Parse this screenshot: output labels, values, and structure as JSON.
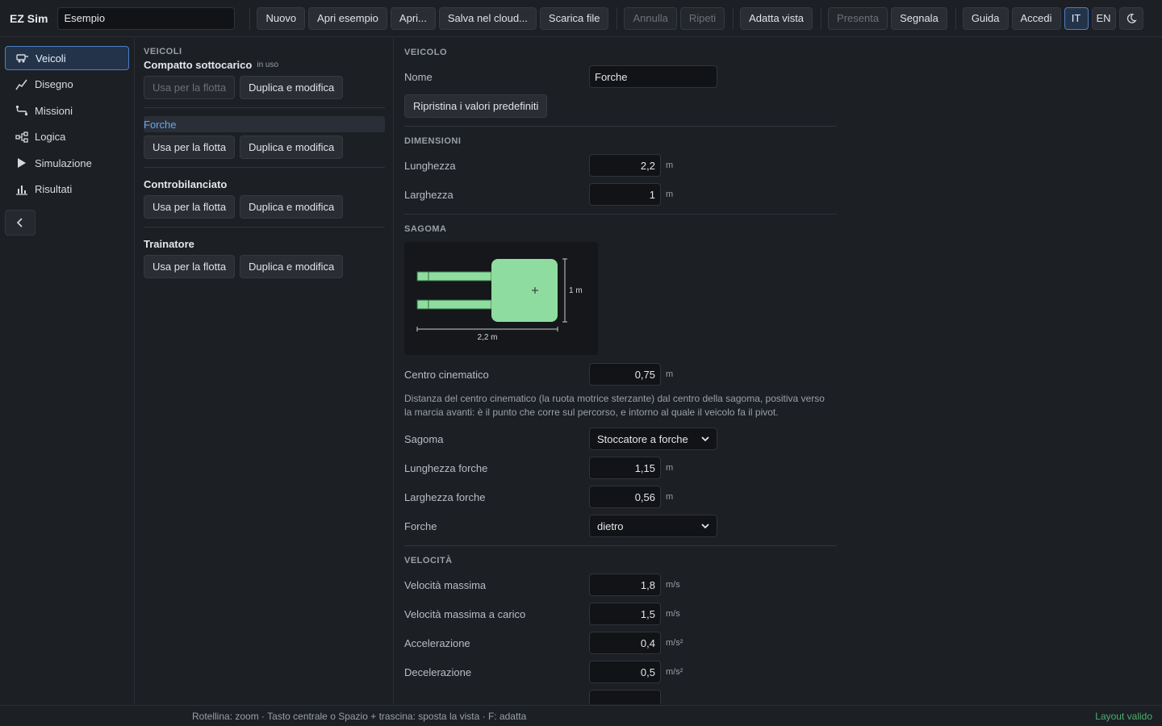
{
  "app": {
    "brand": "EZ Sim",
    "project_name": "Esempio"
  },
  "toolbar": {
    "file_buttons": [
      "Nuovo",
      "Apri esempio",
      "Apri...",
      "Salva nel cloud...",
      "Scarica file"
    ],
    "undo": "Annulla",
    "redo": "Ripeti",
    "fit_view": "Adatta vista",
    "present": "Presenta",
    "report": "Segnala",
    "help": "Guida",
    "login": "Accedi",
    "lang_it": "IT",
    "lang_en": "EN",
    "theme_icon": "moon-icon"
  },
  "nav": {
    "items": [
      {
        "label": "Veicoli",
        "icon": "vehicle-icon",
        "active": true
      },
      {
        "label": "Disegno",
        "icon": "line-chart-icon",
        "active": false
      },
      {
        "label": "Missioni",
        "icon": "route-icon",
        "active": false
      },
      {
        "label": "Logica",
        "icon": "logic-icon",
        "active": false
      },
      {
        "label": "Simulazione",
        "icon": "play-icon",
        "active": false
      },
      {
        "label": "Risultati",
        "icon": "bar-chart-icon",
        "active": false
      }
    ],
    "collapse_icon": "chevron-left-icon"
  },
  "vehicles": {
    "section_label": "VEICOLI",
    "use_label": "Usa per la flotta",
    "dup_label": "Duplica e modifica",
    "in_use_label": "in uso",
    "list": [
      {
        "name": "Compatto sottocarico",
        "in_use": true,
        "selected": false
      },
      {
        "name": "Forche",
        "in_use": false,
        "selected": true
      },
      {
        "name": "Controbilanciato",
        "in_use": false,
        "selected": false
      },
      {
        "name": "Trainatore",
        "in_use": false,
        "selected": false
      }
    ]
  },
  "detail": {
    "vehicle": {
      "title": "VEICOLO",
      "name_label": "Nome",
      "name_value": "Forche",
      "reset_label": "Ripristina i valori predefiniti"
    },
    "dimensions": {
      "title": "DIMENSIONI",
      "length_label": "Lunghezza",
      "length_value": "2,2",
      "width_label": "Larghezza",
      "width_value": "1",
      "unit": "m"
    },
    "shape": {
      "title": "SAGOMA",
      "preview_length": "2,2 m",
      "preview_width": "1 m",
      "kin_label": "Centro cinematico",
      "kin_value": "0,75",
      "unit": "m",
      "help": "Distanza del centro cinematico (la ruota motrice sterzante) dal centro della sagoma, positiva verso la marcia avanti: è il punto che corre sul percorso, e intorno al quale il veicolo fa il pivot.",
      "shape_label": "Sagoma",
      "shape_value": "Stoccatore a forche",
      "fork_len_label": "Lunghezza forche",
      "fork_len_value": "1,15",
      "fork_width_label": "Larghezza forche",
      "fork_width_value": "0,56",
      "forks_label": "Forche",
      "forks_value": "dietro"
    },
    "speed": {
      "title": "VELOCITÀ",
      "max_label": "Velocità massima",
      "max_value": "1,8",
      "max_unit": "m/s",
      "max_loaded_label": "Velocità massima a carico",
      "max_loaded_value": "1,5",
      "max_loaded_unit": "m/s",
      "accel_label": "Accelerazione",
      "accel_value": "0,4",
      "accel_unit": "m/s²",
      "decel_label": "Decelerazione",
      "decel_value": "0,5",
      "decel_unit": "m/s²"
    }
  },
  "status": {
    "hint": "Rotellina: zoom · Tasto centrale o Spazio + trascina: sposta la vista · F: adatta",
    "valid": "Layout valido"
  },
  "colors": {
    "accent": "#4c7fc4",
    "vehicle_fill": "#8fdca0",
    "ok": "#4caf6e"
  }
}
